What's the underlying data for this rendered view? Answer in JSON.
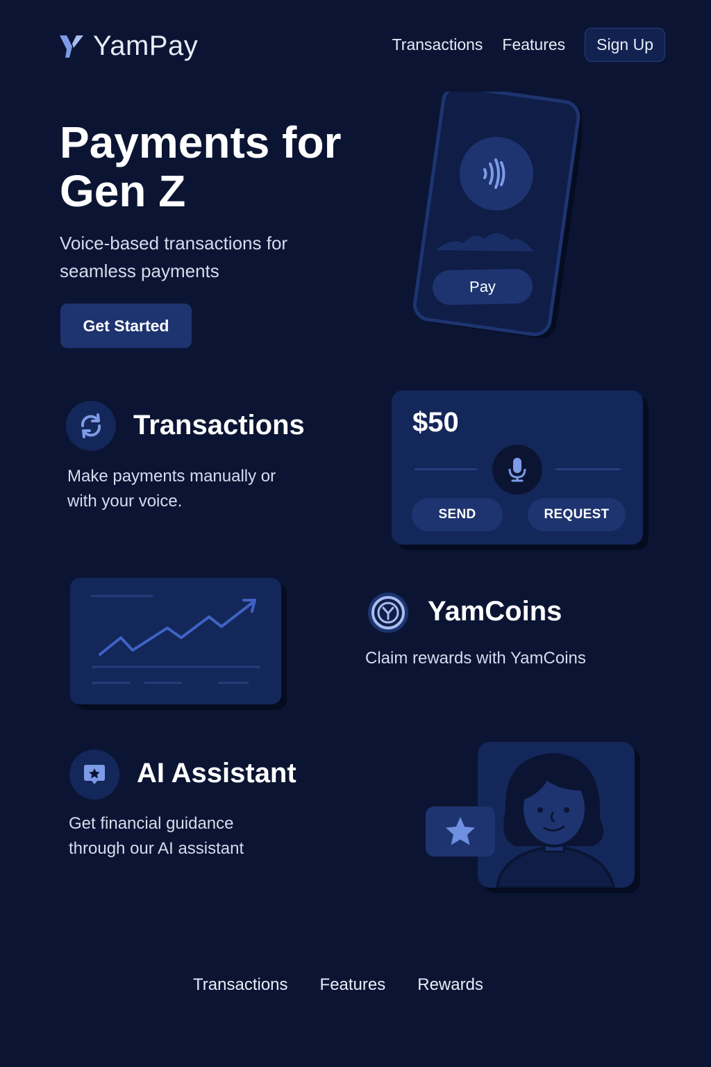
{
  "brand": {
    "name": "YamPay",
    "accent": "#6f8fe0",
    "background": "#0b1533"
  },
  "header": {
    "nav": [
      "Transactions",
      "Features"
    ],
    "signup_label": "Sign Up"
  },
  "hero": {
    "title": "Payments for Gen Z",
    "subtitle": "Voice-based transactions for seamless payments",
    "cta_label": "Get Started",
    "phone_pay_label": "Pay"
  },
  "features": {
    "transactions": {
      "title": "Transactions",
      "description": "Make payments manually or with your voice.",
      "icon": "refresh-icon"
    },
    "yamcoins": {
      "title": "YamCoins",
      "description": "Claim rewards with YamCoins",
      "icon": "yamcoin-icon"
    },
    "ai_assistant": {
      "title": "AI Assistant",
      "description": "Get financial guidance through our AI assistant",
      "icon": "star-chat-icon"
    }
  },
  "transaction_card": {
    "amount": "$50",
    "send_label": "SEND",
    "request_label": "REQUEST",
    "icon": "microphone-icon"
  },
  "footer": {
    "links": [
      "Transactions",
      "Features",
      "Rewards"
    ]
  }
}
